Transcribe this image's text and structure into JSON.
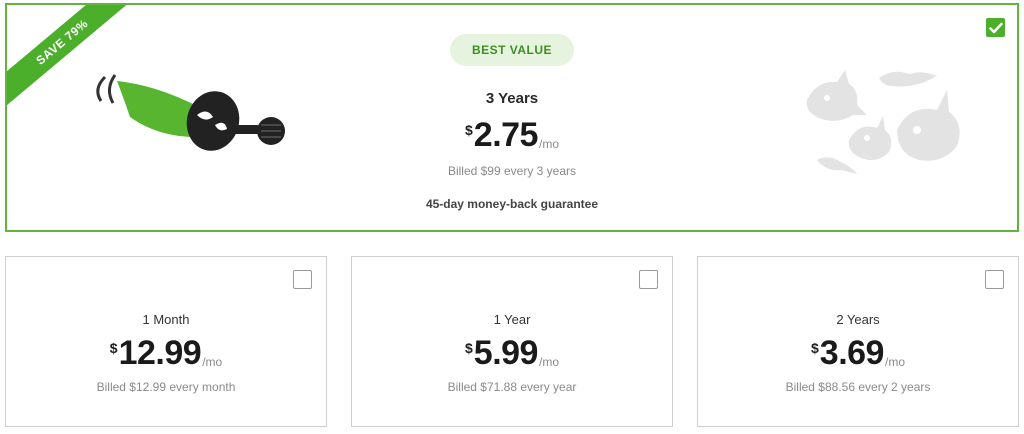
{
  "featured_plan": {
    "ribbon": "SAVE 79%",
    "badge": "BEST VALUE",
    "term": "3 Years",
    "currency": "$",
    "price": "2.75",
    "per": "/mo",
    "billed": "Billed $99 every 3 years",
    "guarantee": "45-day money-back guarantee",
    "selected": true
  },
  "plans": [
    {
      "term": "1 Month",
      "currency": "$",
      "price": "12.99",
      "per": "/mo",
      "billed": "Billed $12.99 every month",
      "selected": false
    },
    {
      "term": "1 Year",
      "currency": "$",
      "price": "5.99",
      "per": "/mo",
      "billed": "Billed $71.88 every year",
      "selected": false
    },
    {
      "term": "2 Years",
      "currency": "$",
      "price": "3.69",
      "per": "/mo",
      "billed": "Billed $88.56 every 2 years",
      "selected": false
    }
  ],
  "icons": {
    "check": "checkmark-icon",
    "mascot": "mascot-hero-illustration",
    "monsters": "monsters-illustration"
  },
  "colors": {
    "accent": "#4caf2c",
    "badge_bg": "#e6f4df",
    "badge_text": "#3d8f23"
  }
}
